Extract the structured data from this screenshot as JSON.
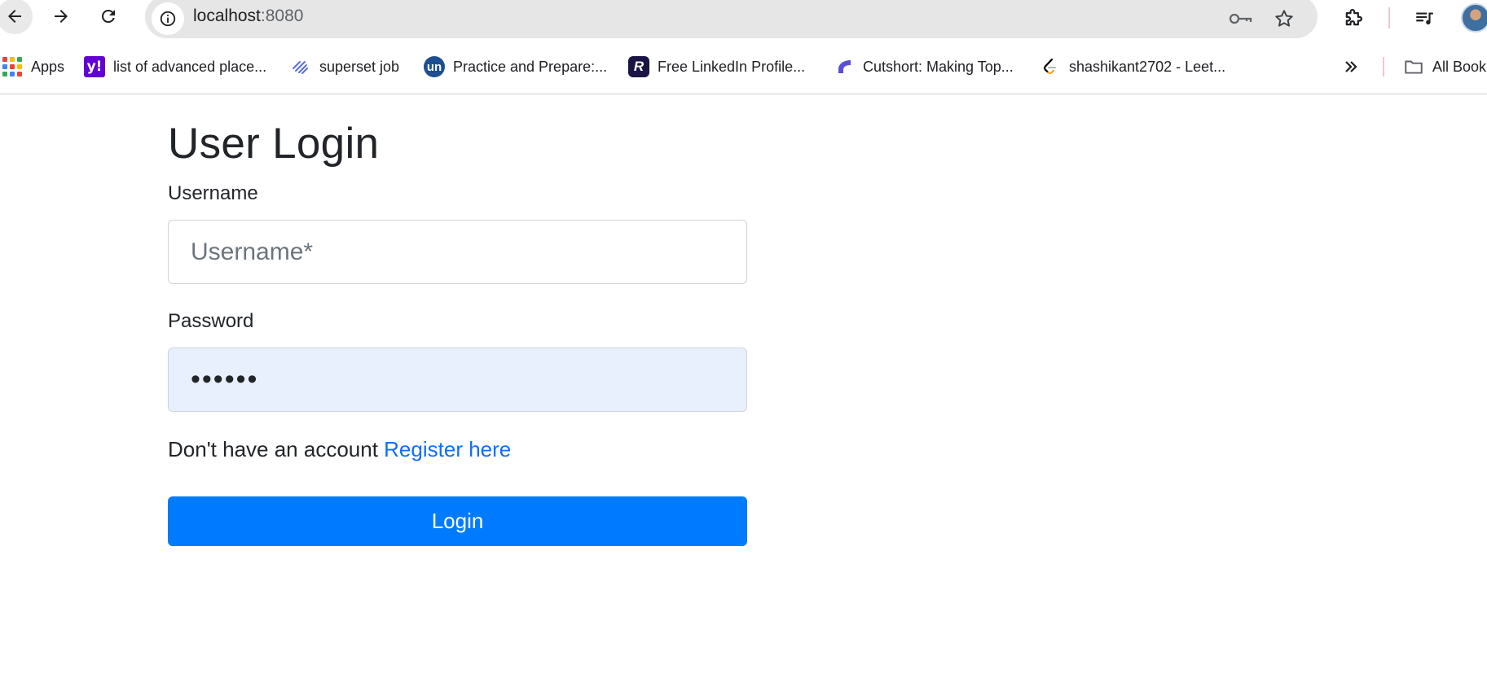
{
  "browser": {
    "url_host": "localhost",
    "url_port": ":8080",
    "bookmarks": [
      {
        "label": "Apps",
        "icon": "apps-grid-icon"
      },
      {
        "label": "list of advanced place...",
        "icon": "yahoo-icon"
      },
      {
        "label": "superset job",
        "icon": "superset-icon"
      },
      {
        "label": "Practice and Prepare:...",
        "icon": "unstop-icon"
      },
      {
        "label": "Free LinkedIn Profile...",
        "icon": "resume-r-icon"
      },
      {
        "label": "Cutshort: Making Top...",
        "icon": "cutshort-icon"
      },
      {
        "label": "shashikant2702 - Leet...",
        "icon": "leetcode-icon"
      }
    ],
    "all_bookmarks_label": "All Book",
    "favicon_text": {
      "yahoo": "y!",
      "unstop": "un",
      "resume": "R"
    }
  },
  "login": {
    "title": "User Login",
    "username_label": "Username",
    "username_placeholder": "Username*",
    "username_value": "",
    "password_label": "Password",
    "password_value": "••••••",
    "register_prompt": "Don't have an account",
    "register_link": "Register here",
    "login_button": "Login"
  },
  "colors": {
    "primary": "#007bff",
    "link": "#0d6efd",
    "autofill_bg": "#e8f0fe"
  }
}
